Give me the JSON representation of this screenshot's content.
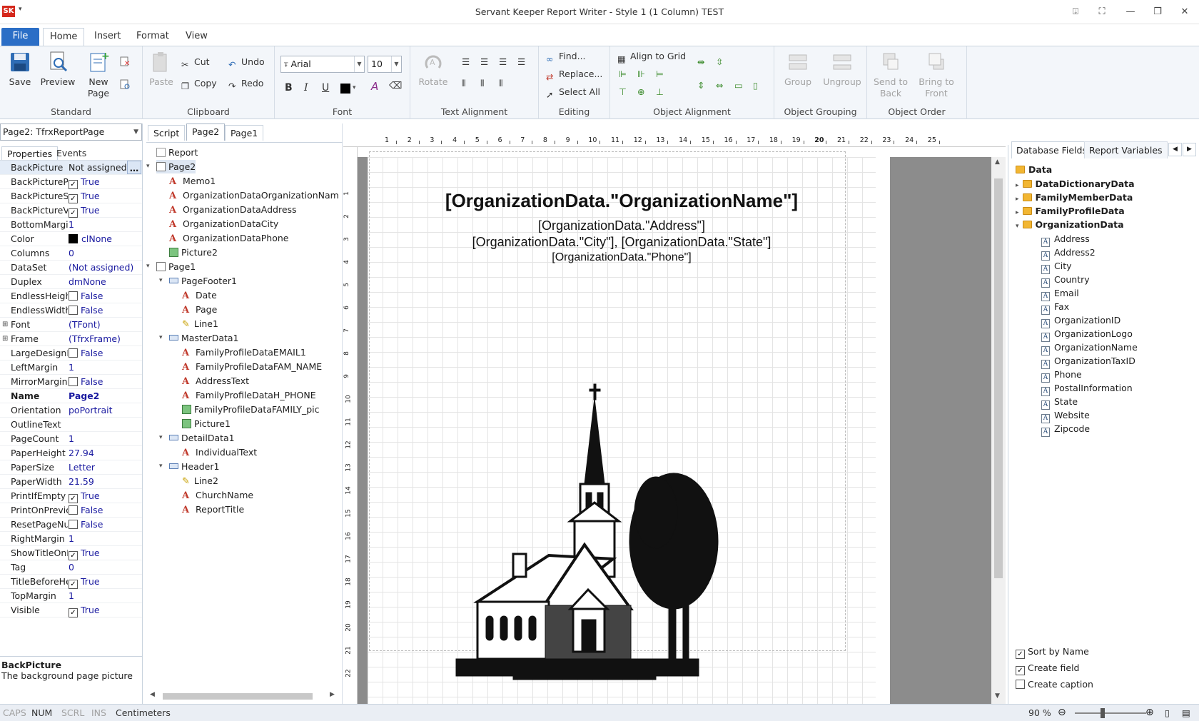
{
  "window": {
    "title": "Servant Keeper Report Writer - Style 1 (1 Column) TEST",
    "logo": "SK"
  },
  "menu_tabs": [
    "File",
    "Home",
    "Insert",
    "Format",
    "View"
  ],
  "ribbon": {
    "standard": {
      "label": "Standard",
      "save": "Save",
      "preview": "Preview",
      "new_page": "New Page"
    },
    "clipboard": {
      "label": "Clipboard",
      "paste": "Paste",
      "cut": "Cut",
      "copy": "Copy",
      "undo": "Undo",
      "redo": "Redo"
    },
    "font": {
      "label": "Font",
      "family": "Arial",
      "size": "10"
    },
    "text_alignment": {
      "label": "Text Alignment",
      "rotate": "Rotate"
    },
    "editing": {
      "label": "Editing",
      "find": "Find...",
      "replace": "Replace...",
      "select_all": "Select All"
    },
    "object_alignment": {
      "label": "Object Alignment",
      "align_to_grid": "Align to Grid"
    },
    "object_grouping": {
      "label": "Object Grouping",
      "group": "Group",
      "ungroup": "Ungroup"
    },
    "object_order": {
      "label": "Object Order",
      "send_to_back": "Send to Back",
      "bring_to_front": "Bring to Front"
    }
  },
  "properties": {
    "object_selector": "Page2: TfrxReportPage",
    "tabs": [
      "Properties",
      "Events"
    ],
    "rows": [
      {
        "name": "BackPicture",
        "value": "Not assigned)",
        "type": "ellipsis"
      },
      {
        "name": "BackPicturePri",
        "value": "True",
        "type": "check"
      },
      {
        "name": "BackPictureStr",
        "value": "True",
        "type": "check"
      },
      {
        "name": "BackPictureVis",
        "value": "True",
        "type": "check"
      },
      {
        "name": "BottomMargin",
        "value": "1",
        "type": "text"
      },
      {
        "name": "Color",
        "value": "clNone",
        "type": "color"
      },
      {
        "name": "Columns",
        "value": "0",
        "type": "text"
      },
      {
        "name": "DataSet",
        "value": "(Not assigned)",
        "type": "text"
      },
      {
        "name": "Duplex",
        "value": "dmNone",
        "type": "text"
      },
      {
        "name": "EndlessHeight",
        "value": "False",
        "type": "uncheck"
      },
      {
        "name": "EndlessWidth",
        "value": "False",
        "type": "uncheck"
      },
      {
        "name": "Font",
        "value": "(TFont)",
        "type": "expand"
      },
      {
        "name": "Frame",
        "value": "(TfrxFrame)",
        "type": "expand"
      },
      {
        "name": "LargeDesignH",
        "value": "False",
        "type": "uncheck"
      },
      {
        "name": "LeftMargin",
        "value": "1",
        "type": "text"
      },
      {
        "name": "MirrorMargin",
        "value": "False",
        "type": "uncheck"
      },
      {
        "name": "Name",
        "value": "Page2",
        "type": "bold"
      },
      {
        "name": "Orientation",
        "value": "poPortrait",
        "type": "text"
      },
      {
        "name": "OutlineText",
        "value": "",
        "type": "text"
      },
      {
        "name": "PageCount",
        "value": "1",
        "type": "text"
      },
      {
        "name": "PaperHeight",
        "value": "27.94",
        "type": "text"
      },
      {
        "name": "PaperSize",
        "value": "Letter",
        "type": "text"
      },
      {
        "name": "PaperWidth",
        "value": "21.59",
        "type": "text"
      },
      {
        "name": "PrintIfEmpty",
        "value": "True",
        "type": "check"
      },
      {
        "name": "PrintOnPrevio",
        "value": "False",
        "type": "uncheck"
      },
      {
        "name": "ResetPageNu",
        "value": "False",
        "type": "uncheck"
      },
      {
        "name": "RightMargin",
        "value": "1",
        "type": "text"
      },
      {
        "name": "ShowTitleOnP",
        "value": "True",
        "type": "check"
      },
      {
        "name": "Tag",
        "value": "0",
        "type": "text"
      },
      {
        "name": "TitleBeforeHe",
        "value": "True",
        "type": "check"
      },
      {
        "name": "TopMargin",
        "value": "1",
        "type": "text"
      },
      {
        "name": "Visible",
        "value": "True",
        "type": "check"
      }
    ],
    "help_title": "BackPicture",
    "help_text": "The background page picture"
  },
  "doc_tabs": [
    "Script",
    "Page2",
    "Page1"
  ],
  "report_tree": [
    {
      "label": "Report",
      "icon": "report",
      "level": 0,
      "caret": ""
    },
    {
      "label": "Page2",
      "icon": "page",
      "level": 0,
      "caret": "v",
      "selected": true
    },
    {
      "label": "Memo1",
      "icon": "text",
      "level": 1,
      "caret": ""
    },
    {
      "label": "OrganizationDataOrganizationNam",
      "icon": "text",
      "level": 1,
      "caret": ""
    },
    {
      "label": "OrganizationDataAddress",
      "icon": "text",
      "level": 1,
      "caret": ""
    },
    {
      "label": "OrganizationDataCity",
      "icon": "text",
      "level": 1,
      "caret": ""
    },
    {
      "label": "OrganizationDataPhone",
      "icon": "text",
      "level": 1,
      "caret": ""
    },
    {
      "label": "Picture2",
      "icon": "picture",
      "level": 1,
      "caret": ""
    },
    {
      "label": "Page1",
      "icon": "page",
      "level": 0,
      "caret": "v"
    },
    {
      "label": "PageFooter1",
      "icon": "band",
      "level": 1,
      "caret": "v"
    },
    {
      "label": "Date",
      "icon": "text",
      "level": 2,
      "caret": ""
    },
    {
      "label": "Page",
      "icon": "text",
      "level": 2,
      "caret": ""
    },
    {
      "label": "Line1",
      "icon": "line",
      "level": 2,
      "caret": ""
    },
    {
      "label": "MasterData1",
      "icon": "band",
      "level": 1,
      "caret": "v"
    },
    {
      "label": "FamilyProfileDataEMAIL1",
      "icon": "text",
      "level": 2,
      "caret": ""
    },
    {
      "label": "FamilyProfileDataFAM_NAME",
      "icon": "text",
      "level": 2,
      "caret": ""
    },
    {
      "label": "AddressText",
      "icon": "text",
      "level": 2,
      "caret": ""
    },
    {
      "label": "FamilyProfileDataH_PHONE",
      "icon": "text",
      "level": 2,
      "caret": ""
    },
    {
      "label": "FamilyProfileDataFAMILY_pic",
      "icon": "picture",
      "level": 2,
      "caret": ""
    },
    {
      "label": "Picture1",
      "icon": "picture",
      "level": 2,
      "caret": ""
    },
    {
      "label": "DetailData1",
      "icon": "band",
      "level": 1,
      "caret": "v"
    },
    {
      "label": "IndividualText",
      "icon": "text",
      "level": 2,
      "caret": ""
    },
    {
      "label": "Header1",
      "icon": "band",
      "level": 1,
      "caret": "v"
    },
    {
      "label": "Line2",
      "icon": "line",
      "level": 2,
      "caret": ""
    },
    {
      "label": "ChurchName",
      "icon": "text",
      "level": 2,
      "caret": ""
    },
    {
      "label": "ReportTitle",
      "icon": "text",
      "level": 2,
      "caret": ""
    }
  ],
  "ruler": {
    "h_ticks": [
      "1",
      "2",
      "3",
      "4",
      "5",
      "6",
      "7",
      "8",
      "9",
      "10",
      "11",
      "12",
      "13",
      "14",
      "15",
      "16",
      "17",
      "18",
      "19",
      "20",
      "21",
      "22",
      "23",
      "24",
      "25"
    ],
    "v_ticks": [
      "1",
      "2",
      "3",
      "4",
      "5",
      "6",
      "7",
      "8",
      "9",
      "10",
      "11",
      "12",
      "13",
      "14",
      "15",
      "16",
      "17",
      "18",
      "19",
      "20",
      "21",
      "22"
    ]
  },
  "canvas": {
    "org_name": "[OrganizationData.\"OrganizationName\"]",
    "address": "[OrganizationData.\"Address\"]",
    "city_state": "[OrganizationData.\"City\"], [OrganizationData.\"State\"]",
    "phone": "[OrganizationData.\"Phone\"]"
  },
  "database": {
    "tabs": [
      "Database Fields",
      "Report Variables"
    ],
    "root": "Data",
    "datasets": [
      "DataDictionaryData",
      "FamilyMemberData",
      "FamilyProfileData",
      "OrganizationData"
    ],
    "fields": [
      "Address",
      "Address2",
      "City",
      "Country",
      "Email",
      "Fax",
      "OrganizationID",
      "OrganizationLogo",
      "OrganizationName",
      "OrganizationTaxID",
      "Phone",
      "PostalInformation",
      "State",
      "Website",
      "Zipcode"
    ],
    "options": [
      {
        "label": "Sort by Name",
        "checked": true
      },
      {
        "label": "Create field",
        "checked": true
      },
      {
        "label": "Create caption",
        "checked": false
      }
    ]
  },
  "status": {
    "caps": "CAPS",
    "num": "NUM",
    "scrl": "SCRL",
    "ins": "INS",
    "units": "Centimeters",
    "zoom": "90 %"
  }
}
